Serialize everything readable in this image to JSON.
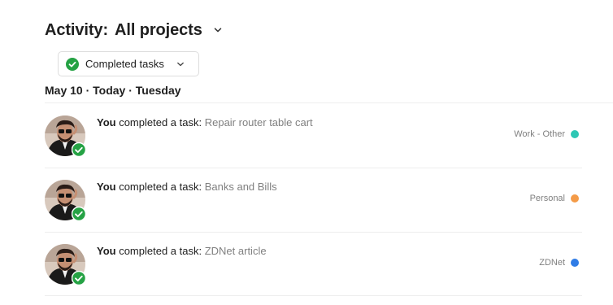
{
  "header": {
    "prefix": "Activity:",
    "project": "All projects",
    "chevron_icon": "chevron-down-icon"
  },
  "filter": {
    "label": "Completed tasks",
    "icon": "check-circle-icon",
    "chevron_icon": "chevron-down-icon",
    "check_color": "#25a244"
  },
  "date_heading": "May 10 · Today · Tuesday",
  "activities": [
    {
      "actor": "You",
      "action": " completed a task: ",
      "task": "Repair router table cart",
      "project": "Work - Other",
      "project_color": "#2dc7b4",
      "avatar_icon": "user-avatar",
      "badge_icon": "check-badge-icon"
    },
    {
      "actor": "You",
      "action": " completed a task: ",
      "task": "Banks and Bills",
      "project": "Personal",
      "project_color": "#f49b48",
      "avatar_icon": "user-avatar",
      "badge_icon": "check-badge-icon"
    },
    {
      "actor": "You",
      "action": " completed a task: ",
      "task": "ZDNet article",
      "project": "ZDNet",
      "project_color": "#2f7ce6",
      "avatar_icon": "user-avatar",
      "badge_icon": "check-badge-icon"
    }
  ]
}
